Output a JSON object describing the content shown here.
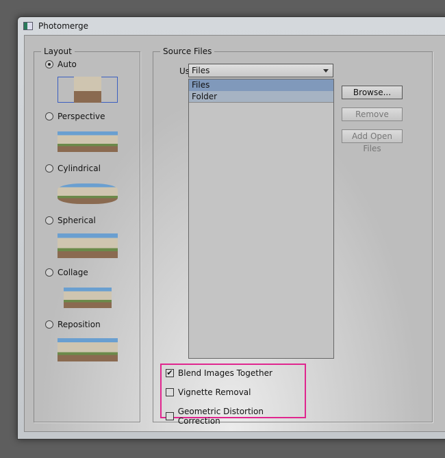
{
  "window": {
    "title": "Photomerge"
  },
  "layout": {
    "label": "Layout",
    "options": [
      {
        "label": "Auto",
        "selected": true
      },
      {
        "label": "Perspective",
        "selected": false
      },
      {
        "label": "Cylindrical",
        "selected": false
      },
      {
        "label": "Spherical",
        "selected": false
      },
      {
        "label": "Collage",
        "selected": false
      },
      {
        "label": "Reposition",
        "selected": false
      }
    ]
  },
  "source": {
    "label": "Source Files",
    "use_label": "Use:",
    "use_value": "Files",
    "options": [
      "Files",
      "Folder"
    ],
    "buttons": {
      "browse": "Browse...",
      "remove": "Remove",
      "add_open": "Add Open Files"
    }
  },
  "options": {
    "blend": {
      "label": "Blend Images Together",
      "checked": true
    },
    "vignette": {
      "label": "Vignette Removal",
      "checked": false
    },
    "geometric": {
      "label": "Geometric Distortion Correction",
      "checked": false
    }
  },
  "colors": {
    "highlight": "#e0258e",
    "selection": "#8099bb"
  }
}
